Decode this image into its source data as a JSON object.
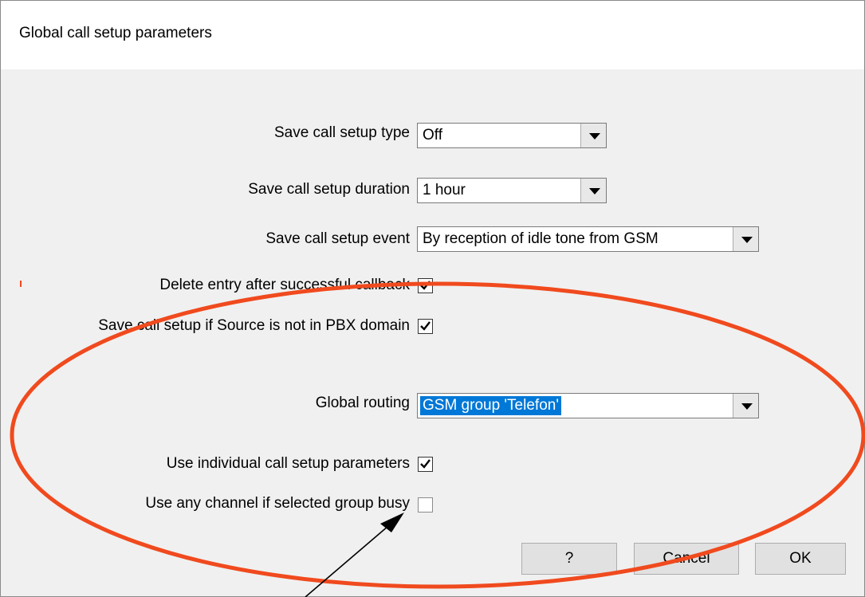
{
  "window": {
    "title": "Global call setup parameters"
  },
  "fields": {
    "call_setup_type": {
      "label": "Save call setup type",
      "value": "Off"
    },
    "call_setup_duration": {
      "label": "Save call setup duration",
      "value": "1 hour"
    },
    "call_setup_event": {
      "label": "Save call setup event",
      "value": "By reception of idle tone from GSM"
    },
    "delete_entry": {
      "label": "Delete entry after successful callback",
      "checked": true
    },
    "save_not_pbx": {
      "label": "Save call setup if Source is not in PBX domain",
      "checked": true
    },
    "global_routing": {
      "label": "Global routing",
      "value": "GSM group 'Telefon'"
    },
    "individual_params": {
      "label": "Use individual call setup parameters",
      "checked": true
    },
    "any_channel": {
      "label": "Use any channel if selected group busy",
      "checked": false
    }
  },
  "buttons": {
    "help": "?",
    "cancel": "Cancel",
    "ok": "OK"
  },
  "annotations": {
    "ellipse_color": "#f04a1e",
    "arrow_color": "#000000"
  },
  "icons": [
    "dropdown-arrow-icon",
    "checkmark-icon"
  ]
}
